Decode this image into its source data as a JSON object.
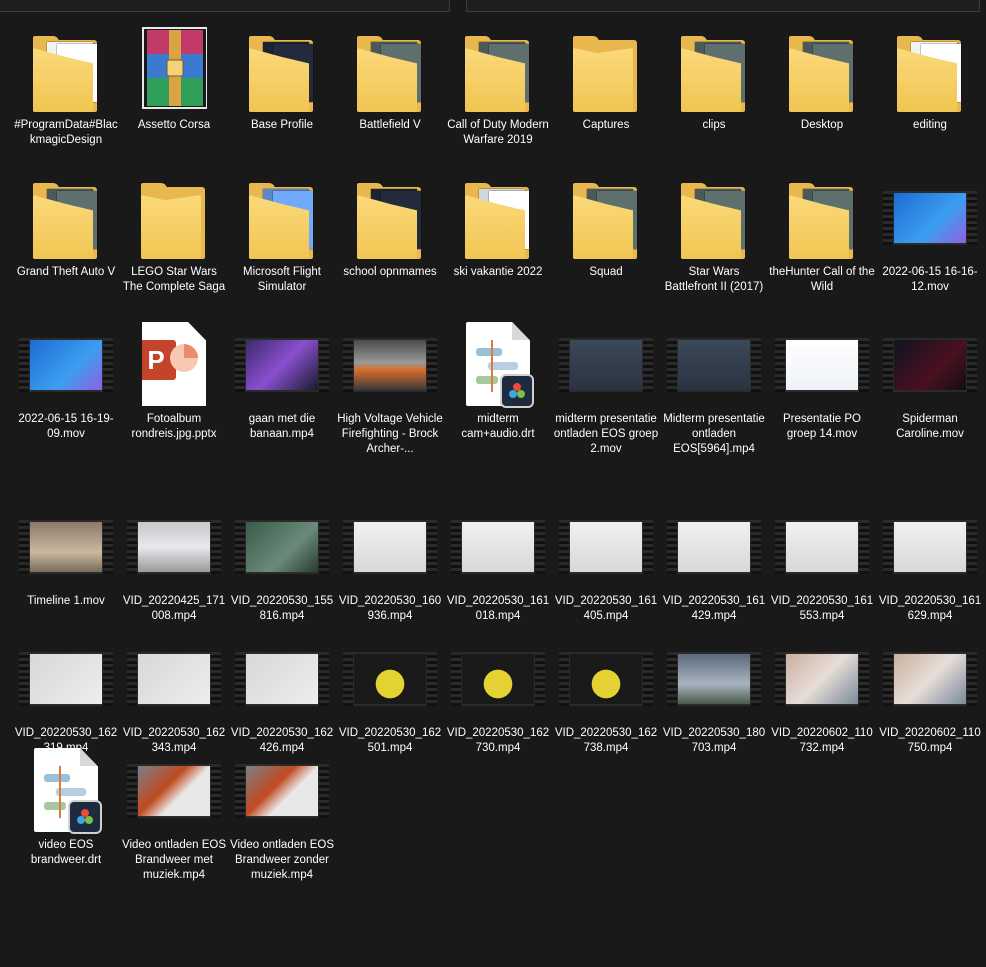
{
  "items": [
    {
      "label": "#ProgramData#BlackmagicDesign",
      "type": "folder",
      "preview": "doc"
    },
    {
      "label": "Assetto Corsa",
      "type": "winrar"
    },
    {
      "label": "Base Profile",
      "type": "folder",
      "preview": "dark"
    },
    {
      "label": "Battlefield V",
      "type": "folder",
      "preview": "game"
    },
    {
      "label": "Call of Duty Modern Warfare 2019",
      "type": "folder",
      "preview": "game"
    },
    {
      "label": "Captures",
      "type": "folder",
      "preview": "none"
    },
    {
      "label": "clips",
      "type": "folder",
      "preview": "game"
    },
    {
      "label": "Desktop",
      "type": "folder",
      "preview": "game"
    },
    {
      "label": "editing",
      "type": "folder",
      "preview": "doc"
    },
    {
      "label": "Grand Theft Auto V",
      "type": "folder",
      "preview": "game"
    },
    {
      "label": "LEGO Star Wars The Complete Saga",
      "type": "folder",
      "preview": "none"
    },
    {
      "label": "Microsoft Flight Simulator",
      "type": "folder",
      "preview": "sky"
    },
    {
      "label": "school opnmames",
      "type": "folder",
      "preview": "dark"
    },
    {
      "label": "ski vakantie 2022",
      "type": "folder",
      "preview": "snow"
    },
    {
      "label": "Squad",
      "type": "folder",
      "preview": "game"
    },
    {
      "label": "Star Wars Battlefront II (2017)",
      "type": "folder",
      "preview": "game"
    },
    {
      "label": "theHunter  Call of the Wild",
      "type": "folder",
      "preview": "game"
    },
    {
      "label": "2022-06-15 16-16-12.mov",
      "type": "video",
      "frame": "blue"
    },
    {
      "label": "2022-06-15 16-19-09.mov",
      "type": "video",
      "frame": "blue"
    },
    {
      "label": "Fotoalbum rondreis.jpg.pptx",
      "type": "pptx"
    },
    {
      "label": "gaan met die banaan.mp4",
      "type": "video",
      "frame": "purple"
    },
    {
      "label": "High Voltage Vehicle Firefighting - Brock Archer-...",
      "type": "video",
      "frame": "fire"
    },
    {
      "label": "midterm cam+audio.drt",
      "type": "drt"
    },
    {
      "label": "midterm presentatie ontladen EOS groep 2.mov",
      "type": "video",
      "frame": "slide"
    },
    {
      "label": "Midterm presentatie ontladen EOS[5964].mp4",
      "type": "video",
      "frame": "slide"
    },
    {
      "label": "Presentatie PO groep 14.mov",
      "type": "video",
      "frame": "white"
    },
    {
      "label": "Spiderman Caroline.mov",
      "type": "video",
      "frame": "dark"
    },
    {
      "label": "Timeline 1.mov",
      "type": "video",
      "frame": "street"
    },
    {
      "label": "VID_20220425_171008.mp4",
      "type": "video",
      "frame": "box"
    },
    {
      "label": "VID_20220530_155816.mp4",
      "type": "video",
      "frame": "green"
    },
    {
      "label": "VID_20220530_160936.mp4",
      "type": "video",
      "frame": "scale"
    },
    {
      "label": "VID_20220530_161018.mp4",
      "type": "video",
      "frame": "scale"
    },
    {
      "label": "VID_20220530_161405.mp4",
      "type": "video",
      "frame": "scale"
    },
    {
      "label": "VID_20220530_161429.mp4",
      "type": "video",
      "frame": "scale"
    },
    {
      "label": "VID_20220530_161553.mp4",
      "type": "video",
      "frame": "scale"
    },
    {
      "label": "VID_20220530_161629.mp4",
      "type": "video",
      "frame": "scale"
    },
    {
      "label": "VID_20220530_162319.mp4",
      "type": "video",
      "frame": "paper"
    },
    {
      "label": "VID_20220530_162343.mp4",
      "type": "video",
      "frame": "paper"
    },
    {
      "label": "VID_20220530_162426.mp4",
      "type": "video",
      "frame": "paper"
    },
    {
      "label": "VID_20220530_162501.mp4",
      "type": "video",
      "frame": "sponge"
    },
    {
      "label": "VID_20220530_162730.mp4",
      "type": "video",
      "frame": "sponge"
    },
    {
      "label": "VID_20220530_162738.mp4",
      "type": "video",
      "frame": "sponge"
    },
    {
      "label": "VID_20220530_180703.mp4",
      "type": "video",
      "frame": "clouds"
    },
    {
      "label": "VID_20220602_110732.mp4",
      "type": "video",
      "frame": "hand"
    },
    {
      "label": "VID_20220602_110750.mp4",
      "type": "video",
      "frame": "hand"
    },
    {
      "label": "video EOS brandweer.drt",
      "type": "drt"
    },
    {
      "label": "Video ontladen EOS Brandweer met muziek.mp4",
      "type": "video",
      "frame": "firetext"
    },
    {
      "label": "Video ontladen EOS Brandweer zonder muziek.mp4",
      "type": "video",
      "frame": "firetext"
    }
  ]
}
